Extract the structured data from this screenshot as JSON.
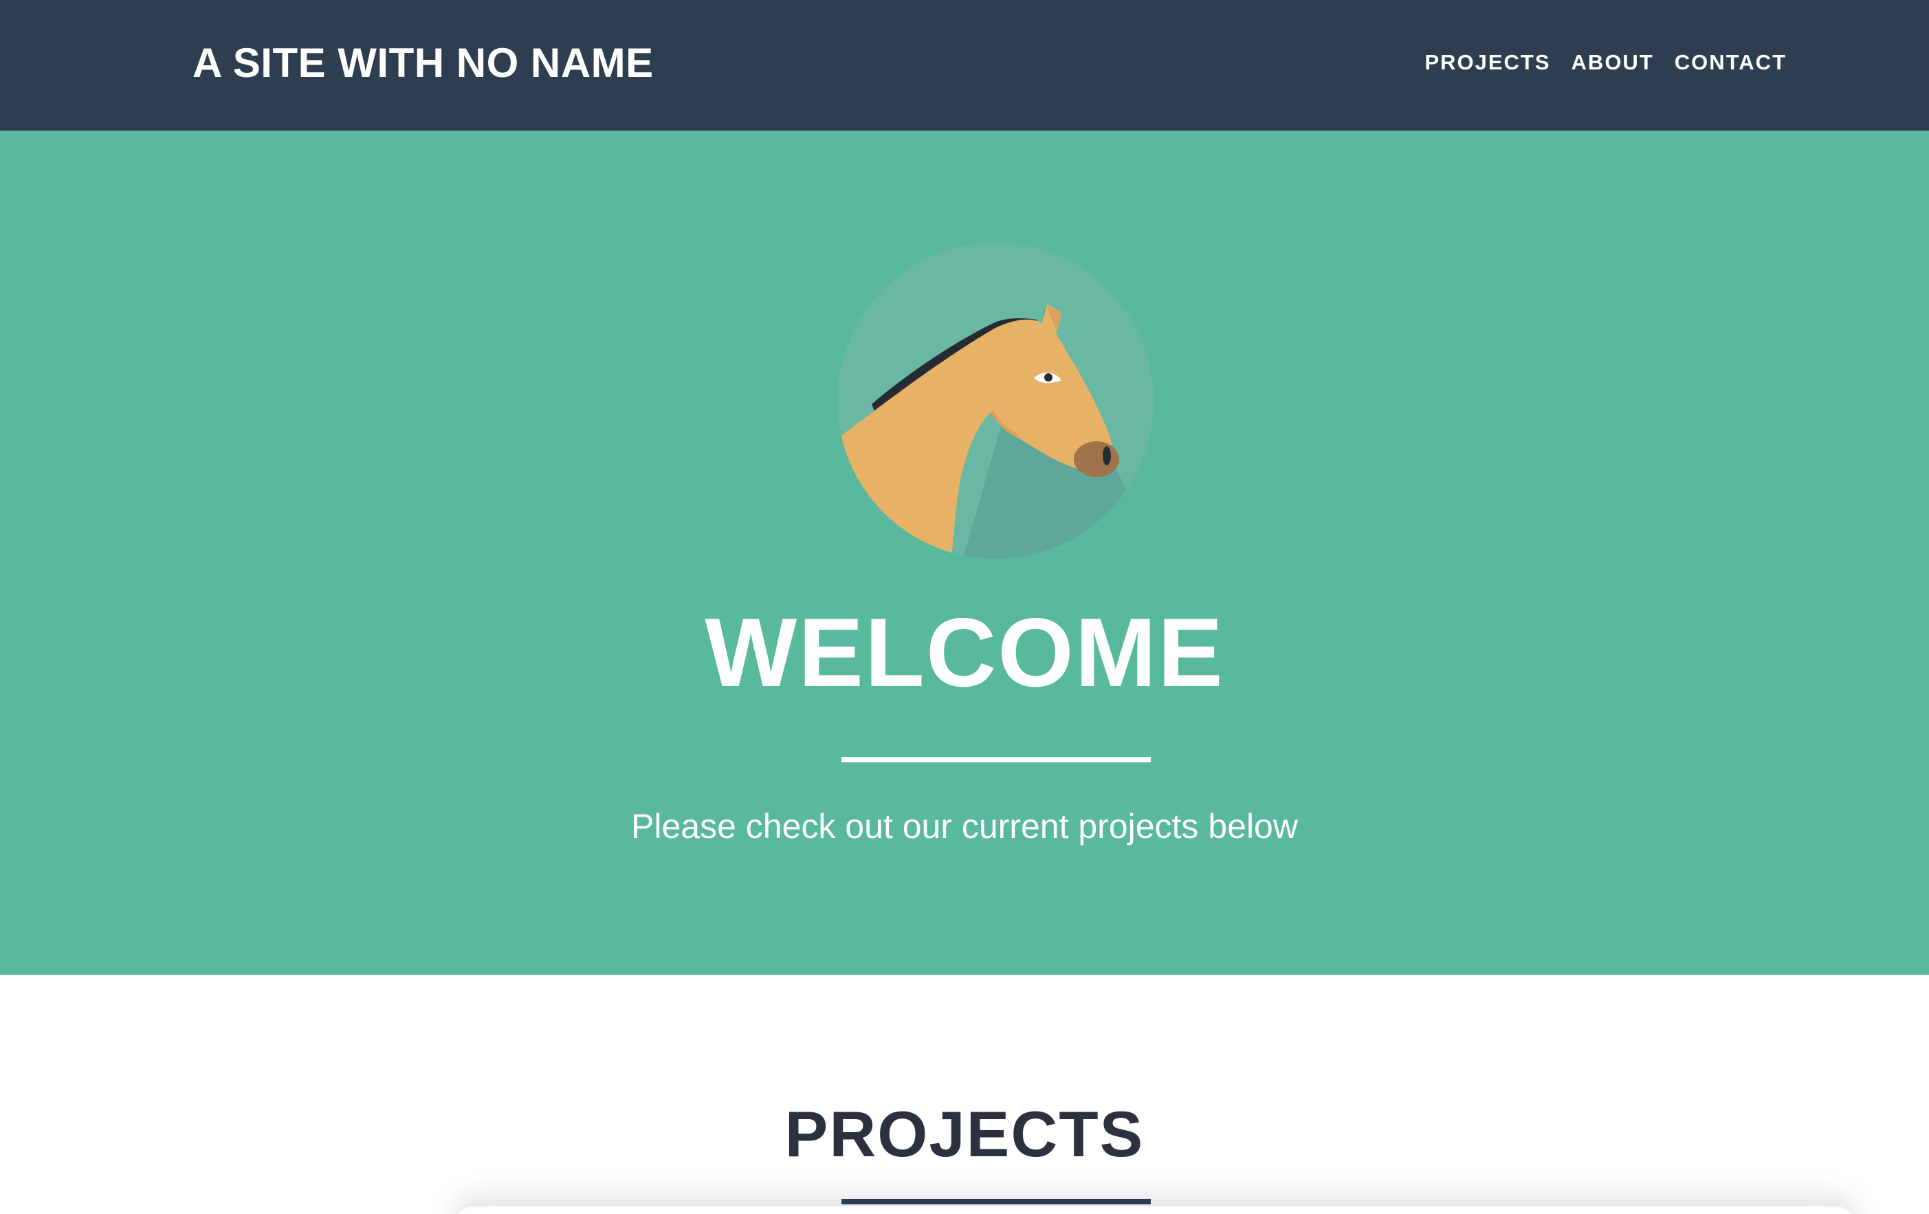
{
  "navbar": {
    "brand": "A SITE WITH NO NAME",
    "links": [
      {
        "label": "PROJECTS"
      },
      {
        "label": "ABOUT"
      },
      {
        "label": "CONTACT"
      }
    ]
  },
  "hero": {
    "avatar_icon": "horse-head-icon",
    "title": "WELCOME",
    "subtitle": "Please check out our current projects below"
  },
  "projects": {
    "title": "PROJECTS"
  },
  "colors": {
    "navbar_bg": "#2f3d50",
    "hero_bg": "#59b99d",
    "horse": "#e7b266",
    "text_dark": "#2c3140"
  }
}
